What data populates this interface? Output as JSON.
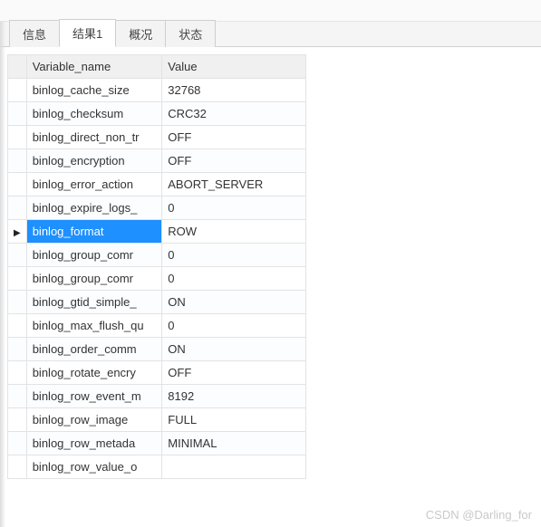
{
  "tabs": [
    {
      "label": "信息",
      "active": false
    },
    {
      "label": "结果1",
      "active": true
    },
    {
      "label": "概况",
      "active": false
    },
    {
      "label": "状态",
      "active": false
    }
  ],
  "table": {
    "headers": {
      "name": "Variable_name",
      "value": "Value"
    },
    "rows": [
      {
        "name": "binlog_cache_size",
        "value": "32768",
        "selected": false
      },
      {
        "name": "binlog_checksum",
        "value": "CRC32",
        "selected": false
      },
      {
        "name": "binlog_direct_non_tr",
        "value": "OFF",
        "selected": false
      },
      {
        "name": "binlog_encryption",
        "value": "OFF",
        "selected": false
      },
      {
        "name": "binlog_error_action",
        "value": "ABORT_SERVER",
        "selected": false
      },
      {
        "name": "binlog_expire_logs_",
        "value": "0",
        "selected": false
      },
      {
        "name": "binlog_format",
        "value": "ROW",
        "selected": true
      },
      {
        "name": "binlog_group_comr",
        "value": "0",
        "selected": false
      },
      {
        "name": "binlog_group_comr",
        "value": "0",
        "selected": false
      },
      {
        "name": "binlog_gtid_simple_",
        "value": "ON",
        "selected": false
      },
      {
        "name": "binlog_max_flush_qu",
        "value": "0",
        "selected": false
      },
      {
        "name": "binlog_order_comm",
        "value": "ON",
        "selected": false
      },
      {
        "name": "binlog_rotate_encry",
        "value": "OFF",
        "selected": false
      },
      {
        "name": "binlog_row_event_m",
        "value": "8192",
        "selected": false
      },
      {
        "name": "binlog_row_image",
        "value": "FULL",
        "selected": false
      },
      {
        "name": "binlog_row_metada",
        "value": "MINIMAL",
        "selected": false
      },
      {
        "name": "binlog_row_value_o",
        "value": "",
        "selected": false
      }
    ]
  },
  "watermark": "CSDN @Darling_for"
}
